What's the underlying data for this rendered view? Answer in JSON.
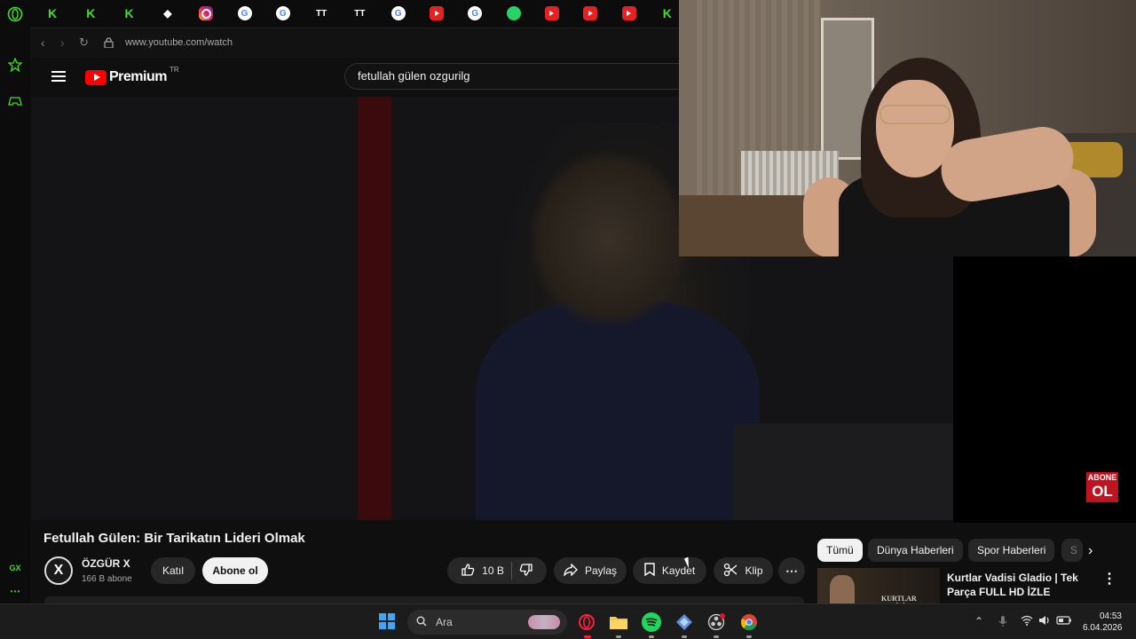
{
  "gx_sidebar": {
    "bottom_label": "GX",
    "more_label": "⋯"
  },
  "speed_dial": [
    {
      "icon": "k-icon",
      "glyph": "K"
    },
    {
      "icon": "k-icon",
      "glyph": "K"
    },
    {
      "icon": "k-icon",
      "glyph": "K"
    },
    {
      "icon": "discord-icon",
      "glyph": "◆"
    },
    {
      "icon": "instagram-icon",
      "glyph": ""
    },
    {
      "icon": "google-icon",
      "glyph": "G"
    },
    {
      "icon": "google-icon",
      "glyph": "G"
    },
    {
      "icon": "twitch-tracker-icon",
      "glyph": "TT"
    },
    {
      "icon": "twitch-tracker-icon",
      "glyph": "TT"
    },
    {
      "icon": "google-icon",
      "glyph": "G"
    },
    {
      "icon": "youtube-icon",
      "glyph": ""
    },
    {
      "icon": "google-icon",
      "glyph": "G"
    },
    {
      "icon": "whatsapp-icon",
      "glyph": ""
    },
    {
      "icon": "youtube-icon",
      "glyph": ""
    },
    {
      "icon": "youtube-icon",
      "glyph": ""
    },
    {
      "icon": "youtube-icon",
      "glyph": ""
    },
    {
      "icon": "k-icon",
      "glyph": "K"
    }
  ],
  "browser": {
    "url": "www.youtube.com/watch"
  },
  "youtube": {
    "logo_text": "Premium",
    "region": "TR",
    "search_value": "fetullah gülen  ozgurilg",
    "badge_top": "ABONE",
    "badge_bottom": "OL",
    "video_title": "Fetullah Gülen: Bir Tarikatın Lideri Olmak",
    "channel": {
      "avatar_glyph": "X",
      "name": "ÖZGÜR X",
      "subs": "166 B abone"
    },
    "buttons": {
      "join": "Katıl",
      "subscribe": "Abone ol",
      "likes": "10 B",
      "share": "Paylaş",
      "save": "Kaydet",
      "clip": "Klip",
      "more": "⋯"
    },
    "chips": [
      "Tümü",
      "Dünya Haberleri",
      "Spor Haberleri",
      "S"
    ],
    "recommended": {
      "thumb_text": "KURTLAR VADİSİ",
      "title": "Kurtlar Vadisi Gladio | Tek Parça FULL HD İZLE"
    }
  },
  "taskbar": {
    "search_placeholder": "Ara",
    "time": "04:53",
    "date": "6.04.2026"
  },
  "colors": {
    "accent_green": "#3ee01f",
    "yt_red": "#ff0000",
    "badge_red": "#c1121f"
  }
}
